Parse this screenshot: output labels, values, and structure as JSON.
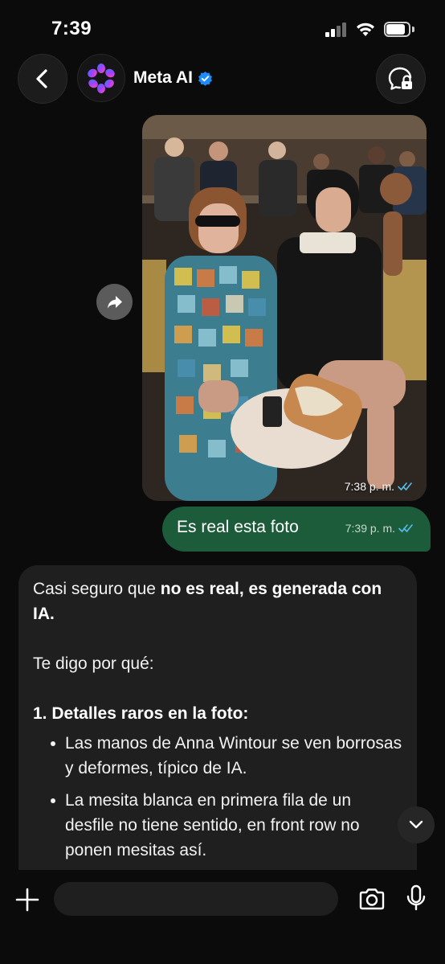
{
  "status_bar": {
    "time": "7:39"
  },
  "header": {
    "title": "Meta AI",
    "icons": {
      "back": "chevron-left-icon",
      "avatar": "meta-ai-logo",
      "verified": "verified-badge-icon",
      "secure": "lock-chat-icon"
    }
  },
  "colors": {
    "background": "#0b0b0b",
    "sent_bubble": "#1d5c3b",
    "received_bubble": "#1f1f1f",
    "verified_blue": "#1d8cf8",
    "read_ticks": "#53bdeb"
  },
  "messages": {
    "photo": {
      "time": "7:38 p. m."
    },
    "sent": {
      "text": "Es real esta foto",
      "time": "7:39 p. m."
    },
    "ai": {
      "intro_plain": "Casi seguro que ",
      "intro_bold": "no es real, es generada con IA.",
      "line2": "Te digo por qué:",
      "section_title": "1. Detalles raros en la foto:",
      "bullets": [
        "Las manos de Anna Wintour se ven borrosas y deformes, típico de IA.",
        "La mesita blanca en primera fila de un desfile no tiene sentido, en front row no ponen mesitas así."
      ]
    }
  },
  "composer": {
    "placeholder": ""
  }
}
